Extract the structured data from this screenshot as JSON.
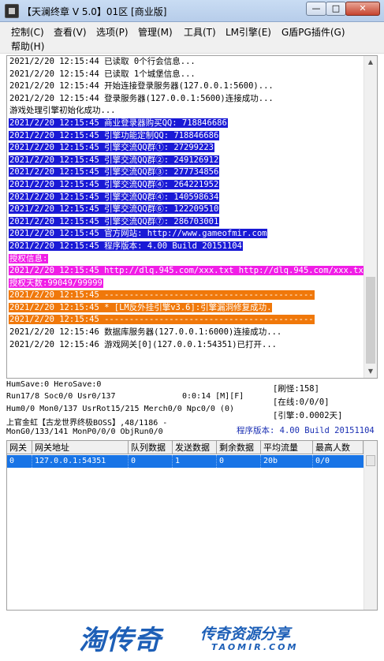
{
  "window": {
    "title": "【天澜终章 V 5.0】01区 [商业版]",
    "minimize_label": "—",
    "maximize_label": "□",
    "close_label": "✕"
  },
  "menu": [
    "控制(C)",
    "查看(V)",
    "选项(P)",
    "管理(M)",
    "工具(T)",
    "LM引擎(E)",
    "G盾PG插件(G)",
    "帮助(H)"
  ],
  "log": [
    {
      "text": "2021/2/20 12:15:44 已读取 0个行会信息...",
      "fg": "#000000",
      "bg": ""
    },
    {
      "text": "2021/2/20 12:15:44 已读取 1个城堡信息...",
      "fg": "#000000",
      "bg": ""
    },
    {
      "text": "2021/2/20 12:15:44 开始连接登录服务器(127.0.0.1:5600)...",
      "fg": "#000000",
      "bg": ""
    },
    {
      "text": "2021/2/20 12:15:44 登录服务器(127.0.0.1:5600)连接成功...",
      "fg": "#000000",
      "bg": ""
    },
    {
      "text": "游戏处理引擎初始化成功...",
      "fg": "#000000",
      "bg": ""
    },
    {
      "text": "2021/2/20 12:15:45 商业登录器购买QQ: 718846686",
      "fg": "#ffffff",
      "bg": "#1a1ad6"
    },
    {
      "text": "2021/2/20 12:15:45 引擎功能定制QQ: 718846686",
      "fg": "#ffffff",
      "bg": "#1a1ad6"
    },
    {
      "text": "2021/2/20 12:15:45 引擎交流QQ群①: 27299223",
      "fg": "#ffffff",
      "bg": "#1a1ad6"
    },
    {
      "text": "2021/2/20 12:15:45 引擎交流QQ群②: 249126912",
      "fg": "#ffffff",
      "bg": "#1a1ad6"
    },
    {
      "text": "2021/2/20 12:15:45 引擎交流QQ群③: 277734856",
      "fg": "#ffffff",
      "bg": "#1a1ad6"
    },
    {
      "text": "2021/2/20 12:15:45 引擎交流QQ群④: 264221952",
      "fg": "#ffffff",
      "bg": "#1a1ad6"
    },
    {
      "text": "2021/2/20 12:15:45 引擎交流QQ群④: 140598634",
      "fg": "#ffffff",
      "bg": "#1a1ad6"
    },
    {
      "text": "2021/2/20 12:15:45 引擎交流QQ群⑥: 122209510",
      "fg": "#ffffff",
      "bg": "#1a1ad6"
    },
    {
      "text": "2021/2/20 12:15:45 引擎交流QQ群⑦: 286703001",
      "fg": "#ffffff",
      "bg": "#1a1ad6"
    },
    {
      "text": "2021/2/20 12:15:45 官方网站: http://www.gameofmir.com",
      "fg": "#ffffff",
      "bg": "#1a1ad6"
    },
    {
      "text": "2021/2/20 12:15:45 程序版本: 4.00 Build 20151104",
      "fg": "#ffffff",
      "bg": "#1a1ad6"
    },
    {
      "text": "授权信息:",
      "fg": "#ffffff",
      "bg": "#f01ee6"
    },
    {
      "text": "2021/2/20 12:15:45 http://dlq.945.com/xxx.txt http://dlq.945.com/xxx.txt",
      "fg": "#ffffff",
      "bg": "#f01ee6"
    },
    {
      "text": "授权天数:99049/99999",
      "fg": "#ffffff",
      "bg": "#f01ee6"
    },
    {
      "text": "2021/2/20 12:15:45 ------------------------------------------",
      "fg": "#ffffff",
      "bg": "#f0780a"
    },
    {
      "text": "2021/2/20 12:15:45 * [LM反外挂引擎v3.6]:引擎漏洞修复成功.",
      "fg": "#ffffff",
      "bg": "#f0780a"
    },
    {
      "text": "2021/2/20 12:15:45 ------------------------------------------",
      "fg": "#ffffff",
      "bg": "#f0780a"
    },
    {
      "text": "2021/2/20 12:15:46 数据库服务器(127.0.0.1:6000)连接成功...",
      "fg": "#000000",
      "bg": ""
    },
    {
      "text": "2021/2/20 12:15:46 游戏网关[0](127.0.0.1:54351)已打开...",
      "fg": "#000000",
      "bg": ""
    }
  ],
  "status": {
    "line1": "HumSave:0 HeroSave:0",
    "line2": "Run17/8 Soc0/0 Usr0/137",
    "timer": "0:0:14 [M][F]",
    "line3": "Hum0/0 Mon0/137 UsrRot15/215 Merch0/0 Npc0/0 (0)",
    "line4": "上官金虹【古龙世界终极BOSS】,48/1186 -",
    "line5": "MonG0/133/141 MonP0/0/0 ObjRun0/0",
    "refresh": "[刷怪:158]",
    "online": "[在线:0/0/0]",
    "engine": "[引擎:0.0002天]",
    "version": "程序版本: 4.00 Build 20151104"
  },
  "table": {
    "headers": [
      "网关",
      "网关地址",
      "队列数据",
      "发送数据",
      "剩余数据",
      "平均流量",
      "最高人数"
    ],
    "rows": [
      [
        "0",
        "127.0.0.1:54351",
        "0",
        "1",
        "0",
        "20b",
        "0/0"
      ]
    ]
  },
  "watermark": {
    "logo": "淘传奇",
    "subtitle": "传奇资源分享",
    "domain": "TAOMIR.COM"
  }
}
